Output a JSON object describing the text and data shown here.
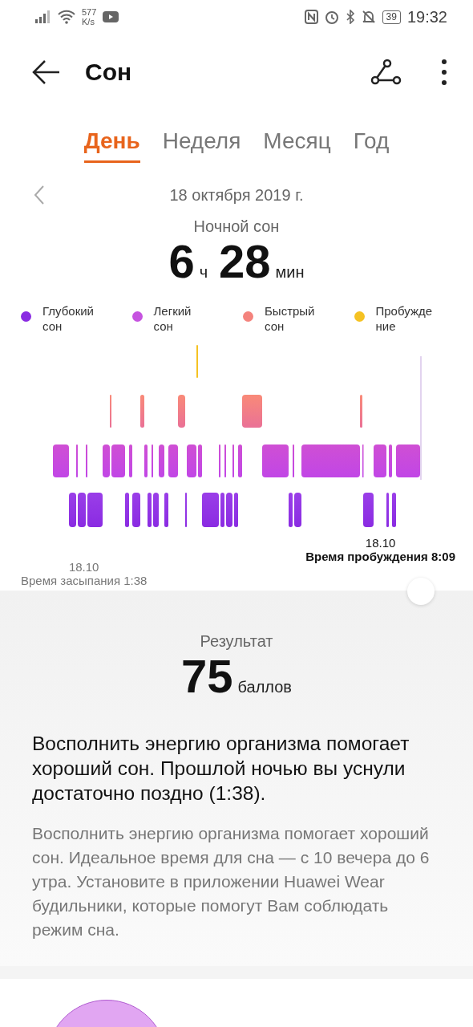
{
  "status_bar": {
    "speed": "577",
    "speed_unit": "K/s",
    "battery": "39",
    "time": "19:32"
  },
  "app_bar": {
    "title": "Сон"
  },
  "tabs": [
    {
      "label": "День",
      "selected": true
    },
    {
      "label": "Неделя",
      "selected": false
    },
    {
      "label": "Месяц",
      "selected": false
    },
    {
      "label": "Год",
      "selected": false
    }
  ],
  "date": "18 октября 2019 г.",
  "summary": {
    "label": "Ночной сон",
    "hours": "6",
    "hours_unit": "ч",
    "minutes": "28",
    "minutes_unit": "мин"
  },
  "legend": [
    {
      "label": "Глубокий сон",
      "color": "#8a2be2"
    },
    {
      "label": "Легкий сон",
      "color": "#c653e0"
    },
    {
      "label": "Быстрый сон",
      "color": "#f4837d"
    },
    {
      "label": "Пробужде ние",
      "color": "#f5c223"
    }
  ],
  "sleep_start": {
    "date": "18.10",
    "label": "Время засыпания 1:38"
  },
  "wake": {
    "date": "18.10",
    "label": "Время пробуждения 8:09"
  },
  "result": {
    "label": "Результат",
    "score": "75",
    "unit": "баллов"
  },
  "advice": "Восполнить энергию организма помогает хороший сон. Прошлой ночью вы уснули достаточно поздно (1:38).",
  "details": "Восполнить энергию организма помогает хороший сон. Идеальное время для сна — с 10 вечера до 6 утра. Установите в приложении Huawei Wear будильники, которые помогут Вам соблюдать режим сна."
}
